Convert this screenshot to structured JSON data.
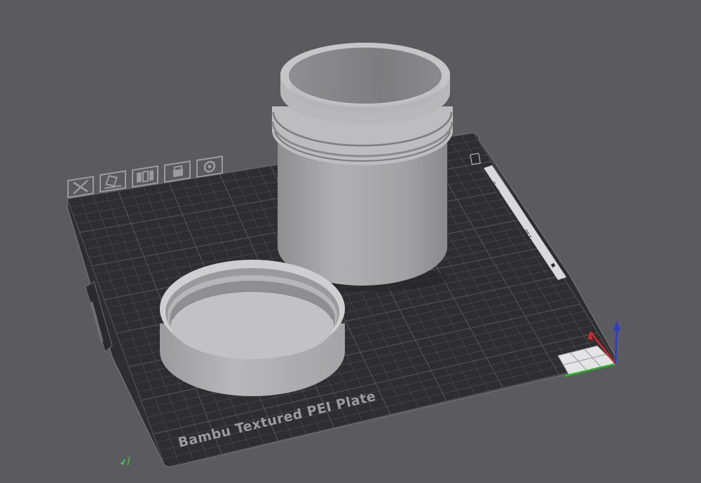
{
  "scene": {
    "background_color": "#5b5b5f",
    "bed": {
      "plate_label": "Bambu Textured PEI Plate",
      "side_marks": [
        "Bambu",
        "PEI",
        "■"
      ],
      "surface_color": "#2e2e32",
      "grid_color": "#505055",
      "bed_icons": [
        "close-icon",
        "auto-orient-icon",
        "arrange-icon",
        "lock-icon",
        "settings-icon"
      ]
    },
    "objects": [
      {
        "name": "Jar body",
        "color": "#a9a9ab"
      },
      {
        "name": "Jar lid",
        "color": "#b4b4b6"
      }
    ],
    "axes": {
      "x_color": "#d42a2a",
      "y_color": "#2ab42a",
      "z_color": "#2a3ad4"
    },
    "origin_label": "✔/",
    "origin_color": "#3fd03f"
  }
}
